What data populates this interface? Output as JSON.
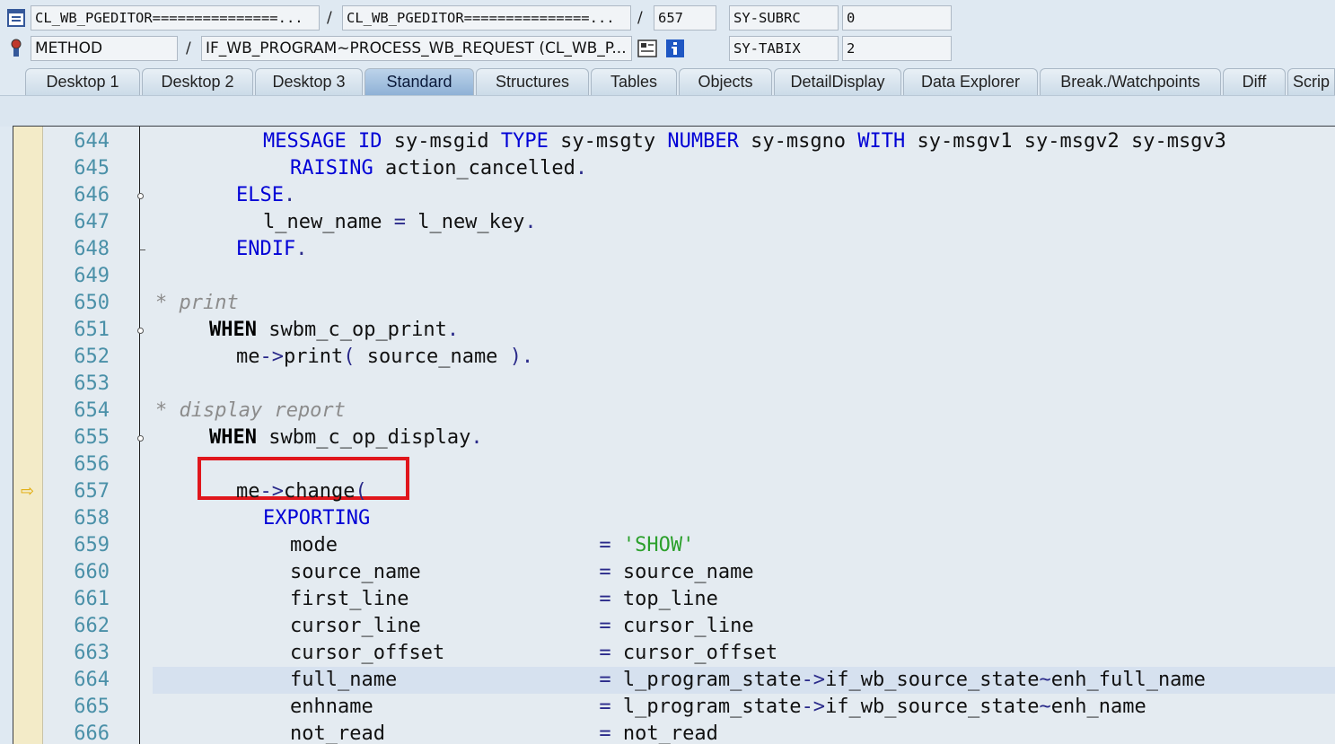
{
  "header": {
    "row1": {
      "program": "CL_WB_PGEDITOR===============...",
      "include": "CL_WB_PGEDITOR===============...",
      "line": "657",
      "var_name": "SY-SUBRC",
      "var_value": "0"
    },
    "row2": {
      "event_type": "METHOD",
      "event_name": "IF_WB_PROGRAM~PROCESS_WB_REQUEST (CL_WB_P...",
      "var_name": "SY-TABIX",
      "var_value": "2"
    },
    "separator": "/"
  },
  "tabs": [
    {
      "label": "Desktop 1",
      "active": false
    },
    {
      "label": "Desktop 2",
      "active": false
    },
    {
      "label": "Desktop 3",
      "active": false
    },
    {
      "label": "Standard",
      "active": true
    },
    {
      "label": "Structures",
      "active": false
    },
    {
      "label": "Tables",
      "active": false
    },
    {
      "label": "Objects",
      "active": false
    },
    {
      "label": "DetailDisplay",
      "active": false
    },
    {
      "label": "Data Explorer",
      "active": false
    },
    {
      "label": "Break./Watchpoints",
      "active": false
    },
    {
      "label": "Diff",
      "active": false
    },
    {
      "label": "Scrip",
      "active": false
    }
  ],
  "editor": {
    "current_line": "657",
    "highlighted_line": "664",
    "lines": [
      {
        "n": "644",
        "tokens": [
          [
            "kw",
            "MESSAGE ID "
          ],
          [
            "",
            "sy-msgid "
          ],
          [
            "kw",
            "TYPE "
          ],
          [
            "",
            "sy-msgty "
          ],
          [
            "kw",
            "NUMBER "
          ],
          [
            "",
            "sy-msgno "
          ],
          [
            "kw",
            "WITH "
          ],
          [
            "",
            "sy-msgv1 sy-msgv2 sy-msgv3"
          ]
        ],
        "indent": 8
      },
      {
        "n": "645",
        "tokens": [
          [
            "kw",
            "RAISING "
          ],
          [
            "",
            "action_cancelled"
          ],
          [
            "op",
            "."
          ]
        ],
        "indent": 10
      },
      {
        "n": "646",
        "tokens": [
          [
            "kw",
            "ELSE"
          ],
          [
            "op",
            "."
          ]
        ],
        "indent": 6
      },
      {
        "n": "647",
        "tokens": [
          [
            "",
            "l_new_name "
          ],
          [
            "op",
            "= "
          ],
          [
            "",
            "l_new_key"
          ],
          [
            "op",
            "."
          ]
        ],
        "indent": 8
      },
      {
        "n": "648",
        "tokens": [
          [
            "kw",
            "ENDIF"
          ],
          [
            "op",
            "."
          ]
        ],
        "indent": 6
      },
      {
        "n": "649",
        "tokens": [],
        "indent": 0
      },
      {
        "n": "650",
        "tokens": [
          [
            "cm",
            "* print"
          ]
        ],
        "indent": 0
      },
      {
        "n": "651",
        "tokens": [
          [
            "kb",
            "WHEN "
          ],
          [
            "",
            "swbm_c_op_print"
          ],
          [
            "op",
            "."
          ]
        ],
        "indent": 4
      },
      {
        "n": "652",
        "tokens": [
          [
            "",
            "me"
          ],
          [
            "op",
            "->"
          ],
          [
            "",
            "print"
          ],
          [
            "op",
            "( "
          ],
          [
            "",
            "source_name "
          ],
          [
            "op",
            ")."
          ]
        ],
        "indent": 6
      },
      {
        "n": "653",
        "tokens": [],
        "indent": 0
      },
      {
        "n": "654",
        "tokens": [
          [
            "cm",
            "* display report"
          ]
        ],
        "indent": 0
      },
      {
        "n": "655",
        "tokens": [
          [
            "kb",
            "WHEN "
          ],
          [
            "",
            "swbm_c_op_display"
          ],
          [
            "op",
            "."
          ]
        ],
        "indent": 4
      },
      {
        "n": "656",
        "tokens": [],
        "indent": 0
      },
      {
        "n": "657",
        "tokens": [
          [
            "",
            "me"
          ],
          [
            "op",
            "->"
          ],
          [
            "",
            "change"
          ],
          [
            "op",
            "("
          ]
        ],
        "indent": 6
      },
      {
        "n": "658",
        "tokens": [
          [
            "kw",
            "EXPORTING"
          ]
        ],
        "indent": 8
      },
      {
        "n": "659",
        "tokens": [
          [
            "",
            "mode                      "
          ],
          [
            "op",
            "= "
          ],
          [
            "str",
            "'SHOW'"
          ]
        ],
        "indent": 10
      },
      {
        "n": "660",
        "tokens": [
          [
            "",
            "source_name               "
          ],
          [
            "op",
            "= "
          ],
          [
            "",
            "source_name"
          ]
        ],
        "indent": 10
      },
      {
        "n": "661",
        "tokens": [
          [
            "",
            "first_line                "
          ],
          [
            "op",
            "= "
          ],
          [
            "",
            "top_line"
          ]
        ],
        "indent": 10
      },
      {
        "n": "662",
        "tokens": [
          [
            "",
            "cursor_line               "
          ],
          [
            "op",
            "= "
          ],
          [
            "",
            "cursor_line"
          ]
        ],
        "indent": 10
      },
      {
        "n": "663",
        "tokens": [
          [
            "",
            "cursor_offset             "
          ],
          [
            "op",
            "= "
          ],
          [
            "",
            "cursor_offset"
          ]
        ],
        "indent": 10
      },
      {
        "n": "664",
        "tokens": [
          [
            "",
            "full_name                 "
          ],
          [
            "op",
            "= "
          ],
          [
            "",
            "l_program_state"
          ],
          [
            "op",
            "->"
          ],
          [
            "",
            "if_wb_source_state"
          ],
          [
            "op",
            "~"
          ],
          [
            "",
            "enh_full_name"
          ]
        ],
        "indent": 10
      },
      {
        "n": "665",
        "tokens": [
          [
            "",
            "enhname                   "
          ],
          [
            "op",
            "= "
          ],
          [
            "",
            "l_program_state"
          ],
          [
            "op",
            "->"
          ],
          [
            "",
            "if_wb_source_state"
          ],
          [
            "op",
            "~"
          ],
          [
            "",
            "enh_name"
          ]
        ],
        "indent": 10
      },
      {
        "n": "666",
        "tokens": [
          [
            "",
            "not_read                  "
          ],
          [
            "op",
            "= "
          ],
          [
            "",
            "not_read"
          ]
        ],
        "indent": 10
      }
    ]
  },
  "icons": {
    "program": "program-icon",
    "method": "method-icon",
    "source": "source-icon",
    "info": "info-icon",
    "execution_arrow": "execution-arrow-icon"
  },
  "colors": {
    "keyword": "#0000d6",
    "comment": "#8c8c8c",
    "string": "#2ca02c",
    "line_number": "#4a90a8",
    "highlight_box": "#e0161c",
    "gutter": "#f3ebc8"
  }
}
